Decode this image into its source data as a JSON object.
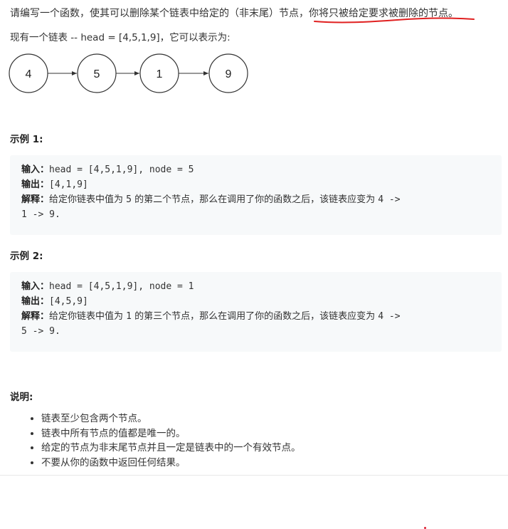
{
  "intro": {
    "text_before": "请编写一个函数，使其可以删除某个链表中给定的（非末尾）节点，",
    "text_highlight": "你将只被给定要求被删除的节点。"
  },
  "list_line": "现有一个链表 -- head = [4,5,1,9]，它可以表示为:",
  "diagram": {
    "nodes": [
      "4",
      "5",
      "1",
      "9"
    ]
  },
  "example1": {
    "title": "示例 1:",
    "input_label": "输入：",
    "input_value": "head = [4,5,1,9], node = 5",
    "output_label": "输出：",
    "output_value": "[4,1,9]",
    "explain_label": "解释：",
    "explain_a": "给定你链表中值为 ",
    "explain_val": "5",
    "explain_b": " 的第二个节点，那么在调用了你的函数之后，该链表应变为 ",
    "explain_c": "4 ->",
    "explain_d": "1 -> 9."
  },
  "example2": {
    "title": "示例 2:",
    "input_label": "输入：",
    "input_value": "head = [4,5,1,9], node = 1",
    "output_label": "输出：",
    "output_value": "[4,5,9]",
    "explain_label": "解释：",
    "explain_a": "给定你链表中值为 ",
    "explain_val": "1",
    "explain_b": " 的第三个节点，那么在调用了你的函数之后，该链表应变为 ",
    "explain_c": "4 ->",
    "explain_d": "5 -> 9."
  },
  "notes": {
    "title": "说明:",
    "items": [
      "链表至少包含两个节点。",
      "链表中所有节点的值都是唯一的。",
      "给定的节点为非末尾节点并且一定是链表中的一个有效节点。",
      "不要从你的函数中返回任何结果。"
    ]
  },
  "colors": {
    "underline": "#e02020",
    "code_bg": "#f7f9fa"
  }
}
